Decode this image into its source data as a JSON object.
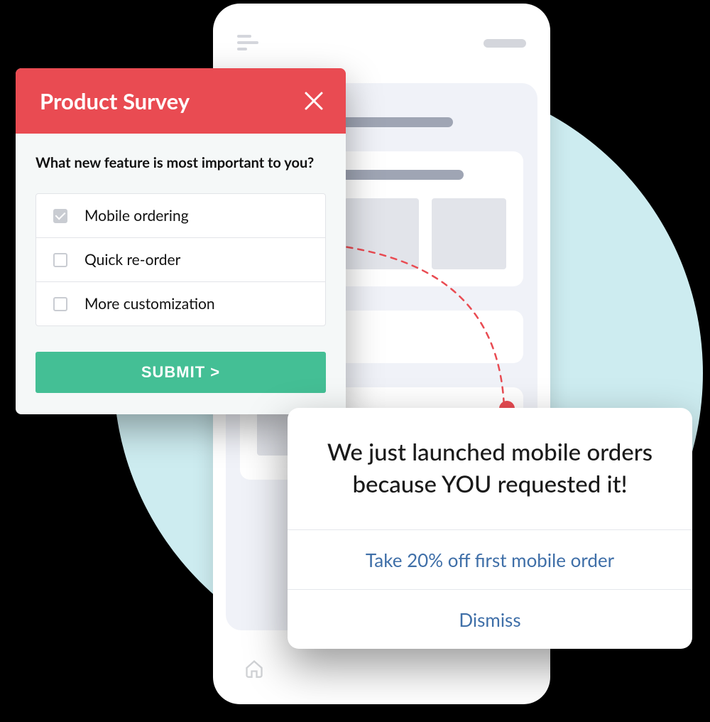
{
  "survey": {
    "title": "Product Survey",
    "question": "What new feature is most important to you?",
    "options": [
      {
        "label": "Mobile ordering",
        "checked": true
      },
      {
        "label": "Quick re-order",
        "checked": false
      },
      {
        "label": "More customization",
        "checked": false
      }
    ],
    "submit_label": "SUBMIT >"
  },
  "notification": {
    "headline": "We just launched mobile orders because YOU requested it!",
    "primary_action": "Take 20% off first mobile order",
    "dismiss_label": "Dismiss"
  },
  "colors": {
    "accent_red": "#e94b52",
    "accent_green": "#44bf95",
    "link_blue": "#3f6fa8",
    "bg_teal": "#cdecf0"
  }
}
